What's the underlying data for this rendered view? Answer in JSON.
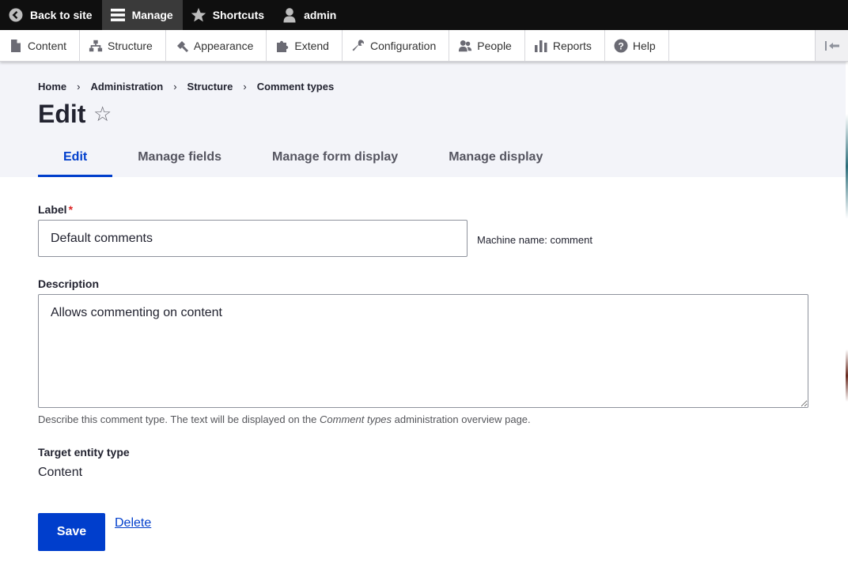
{
  "toolbar": {
    "back_to_site": "Back to site",
    "manage": "Manage",
    "shortcuts": "Shortcuts",
    "user": "admin"
  },
  "tray": {
    "items": [
      {
        "label": "Content",
        "icon": "document-icon"
      },
      {
        "label": "Structure",
        "icon": "sitemap-icon"
      },
      {
        "label": "Appearance",
        "icon": "paintbrush-icon"
      },
      {
        "label": "Extend",
        "icon": "puzzle-icon"
      },
      {
        "label": "Configuration",
        "icon": "wrench-icon"
      },
      {
        "label": "People",
        "icon": "people-icon"
      },
      {
        "label": "Reports",
        "icon": "bar-chart-icon"
      },
      {
        "label": "Help",
        "icon": "help-icon"
      }
    ]
  },
  "breadcrumb": [
    "Home",
    "Administration",
    "Structure",
    "Comment types"
  ],
  "breadcrumb_separator": "›",
  "page": {
    "title": "Edit",
    "star": "☆"
  },
  "tabs": [
    {
      "label": "Edit",
      "active": true
    },
    {
      "label": "Manage fields",
      "active": false
    },
    {
      "label": "Manage form display",
      "active": false
    },
    {
      "label": "Manage display",
      "active": false
    }
  ],
  "form": {
    "label_title": "Label",
    "required_marker": "*",
    "label_value": "Default comments",
    "machine_name": "Machine name: comment",
    "description_title": "Description",
    "description_value": "Allows commenting on content",
    "description_help_before": "Describe this comment type. The text will be displayed on the ",
    "description_help_emphasis": "Comment types",
    "description_help_after": " administration overview page.",
    "target_entity_title": "Target entity type",
    "target_entity_value": "Content",
    "save_label": "Save",
    "delete_label": "Delete"
  },
  "colors": {
    "primary": "#003ecc",
    "toolbar_bg": "#0f0f0f",
    "header_bg": "#f3f4f9",
    "required": "#dc2323"
  }
}
